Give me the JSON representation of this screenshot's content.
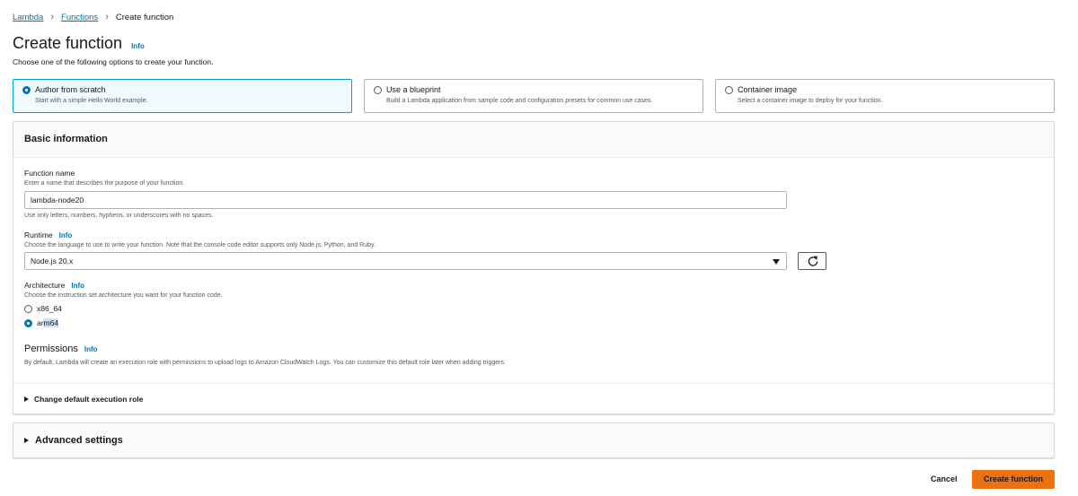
{
  "breadcrumb": {
    "items": [
      "Lambda",
      "Functions"
    ],
    "current": "Create function"
  },
  "page": {
    "title": "Create function",
    "info": "Info",
    "subtitle": "Choose one of the following options to create your function."
  },
  "options": [
    {
      "title": "Author from scratch",
      "desc": "Start with a simple Hello World example.",
      "selected": true
    },
    {
      "title": "Use a blueprint",
      "desc": "Build a Lambda application from sample code and configuration presets for common use cases.",
      "selected": false
    },
    {
      "title": "Container image",
      "desc": "Select a container image to deploy for your function.",
      "selected": false
    }
  ],
  "basic": {
    "heading": "Basic information",
    "function_name": {
      "label": "Function name",
      "desc": "Enter a name that describes the purpose of your function.",
      "value": "lambda-node20",
      "hint": "Use only letters, numbers, hyphens, or underscores with no spaces."
    },
    "runtime": {
      "label": "Runtime",
      "info": "Info",
      "desc": "Choose the language to use to write your function. Note that the console code editor supports only Node.js, Python, and Ruby.",
      "value": "Node.js 20.x"
    },
    "architecture": {
      "label": "Architecture",
      "info": "Info",
      "desc": "Choose the instruction set architecture you want for your function code.",
      "options": [
        "x86_64",
        "arm64"
      ],
      "selected": "arm64"
    },
    "permissions": {
      "heading": "Permissions",
      "info": "Info",
      "desc": "By default, Lambda will create an execution role with permissions to upload logs to Amazon CloudWatch Logs. You can customize this default role later when adding triggers."
    },
    "execution_role": "Change default execution role"
  },
  "advanced": {
    "heading": "Advanced settings"
  },
  "footer": {
    "cancel": "Cancel",
    "create": "Create function"
  },
  "colors": {
    "link": "#0073bb",
    "primary": "#ec7211",
    "selected_border": "#00a1c9",
    "selected_bg": "#f1faff"
  }
}
